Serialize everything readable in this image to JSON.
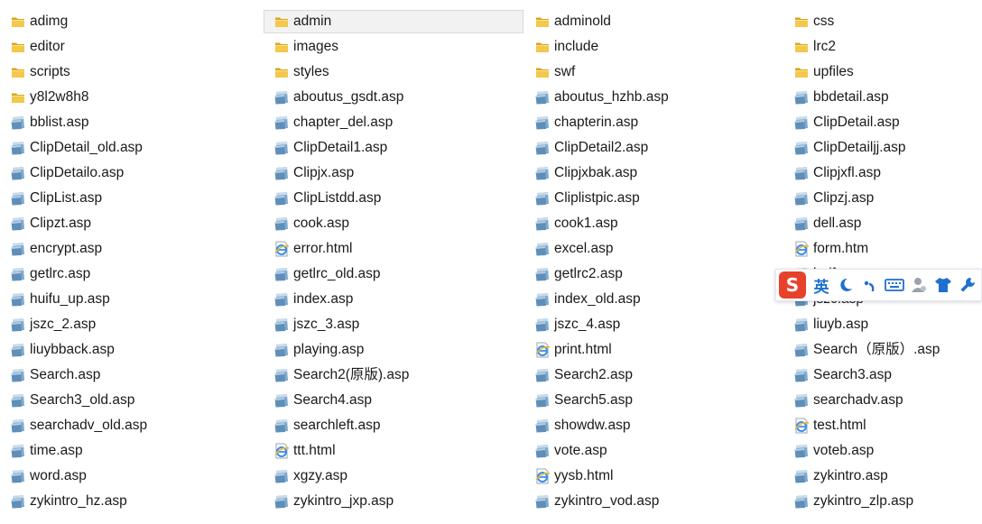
{
  "files": [
    {
      "name": "adimg",
      "type": "folder"
    },
    {
      "name": "editor",
      "type": "folder"
    },
    {
      "name": "scripts",
      "type": "folder"
    },
    {
      "name": "y8l2w8h8",
      "type": "folder"
    },
    {
      "name": "bblist.asp",
      "type": "asp"
    },
    {
      "name": "ClipDetail_old.asp",
      "type": "asp"
    },
    {
      "name": "ClipDetailo.asp",
      "type": "asp"
    },
    {
      "name": "ClipList.asp",
      "type": "asp"
    },
    {
      "name": "Clipzt.asp",
      "type": "asp"
    },
    {
      "name": "encrypt.asp",
      "type": "asp"
    },
    {
      "name": "getlrc.asp",
      "type": "asp"
    },
    {
      "name": "huifu_up.asp",
      "type": "asp"
    },
    {
      "name": "jszc_2.asp",
      "type": "asp"
    },
    {
      "name": "liuybback.asp",
      "type": "asp"
    },
    {
      "name": "Search.asp",
      "type": "asp"
    },
    {
      "name": "Search3_old.asp",
      "type": "asp"
    },
    {
      "name": "searchadv_old.asp",
      "type": "asp"
    },
    {
      "name": "time.asp",
      "type": "asp"
    },
    {
      "name": "word.asp",
      "type": "asp"
    },
    {
      "name": "zykintro_hz.asp",
      "type": "asp"
    },
    {
      "name": "admin",
      "type": "folder",
      "selected": true
    },
    {
      "name": "images",
      "type": "folder"
    },
    {
      "name": "styles",
      "type": "folder"
    },
    {
      "name": "aboutus_gsdt.asp",
      "type": "asp"
    },
    {
      "name": "chapter_del.asp",
      "type": "asp"
    },
    {
      "name": "ClipDetail1.asp",
      "type": "asp"
    },
    {
      "name": "Clipjx.asp",
      "type": "asp"
    },
    {
      "name": "ClipListdd.asp",
      "type": "asp"
    },
    {
      "name": "cook.asp",
      "type": "asp"
    },
    {
      "name": "error.html",
      "type": "html"
    },
    {
      "name": "getlrc_old.asp",
      "type": "asp"
    },
    {
      "name": "index.asp",
      "type": "asp"
    },
    {
      "name": "jszc_3.asp",
      "type": "asp"
    },
    {
      "name": "playing.asp",
      "type": "asp"
    },
    {
      "name": "Search2(原版).asp",
      "type": "asp"
    },
    {
      "name": "Search4.asp",
      "type": "asp"
    },
    {
      "name": "searchleft.asp",
      "type": "asp"
    },
    {
      "name": "ttt.html",
      "type": "html"
    },
    {
      "name": "xgzy.asp",
      "type": "asp"
    },
    {
      "name": "zykintro_jxp.asp",
      "type": "asp"
    },
    {
      "name": "adminold",
      "type": "folder"
    },
    {
      "name": "include",
      "type": "folder"
    },
    {
      "name": "swf",
      "type": "folder"
    },
    {
      "name": "aboutus_hzhb.asp",
      "type": "asp"
    },
    {
      "name": "chapterin.asp",
      "type": "asp"
    },
    {
      "name": "ClipDetail2.asp",
      "type": "asp"
    },
    {
      "name": "Clipjxbak.asp",
      "type": "asp"
    },
    {
      "name": "Cliplistpic.asp",
      "type": "asp"
    },
    {
      "name": "cook1.asp",
      "type": "asp"
    },
    {
      "name": "excel.asp",
      "type": "asp"
    },
    {
      "name": "getlrc2.asp",
      "type": "asp"
    },
    {
      "name": "index_old.asp",
      "type": "asp"
    },
    {
      "name": "jszc_4.asp",
      "type": "asp"
    },
    {
      "name": "print.html",
      "type": "html"
    },
    {
      "name": "Search2.asp",
      "type": "asp"
    },
    {
      "name": "Search5.asp",
      "type": "asp"
    },
    {
      "name": "showdw.asp",
      "type": "asp"
    },
    {
      "name": "vote.asp",
      "type": "asp"
    },
    {
      "name": "yysb.html",
      "type": "html"
    },
    {
      "name": "zykintro_vod.asp",
      "type": "asp"
    },
    {
      "name": "css",
      "type": "folder"
    },
    {
      "name": "lrc2",
      "type": "folder"
    },
    {
      "name": "upfiles",
      "type": "folder"
    },
    {
      "name": "bbdetail.asp",
      "type": "asp"
    },
    {
      "name": "ClipDetail.asp",
      "type": "asp"
    },
    {
      "name": "ClipDetailjj.asp",
      "type": "asp"
    },
    {
      "name": "Clipjxfl.asp",
      "type": "asp"
    },
    {
      "name": "Clipzj.asp",
      "type": "asp"
    },
    {
      "name": "dell.asp",
      "type": "asp"
    },
    {
      "name": "form.htm",
      "type": "html"
    },
    {
      "name": "huif",
      "type": "asp"
    },
    {
      "name": "jszc.asp",
      "type": "asp"
    },
    {
      "name": "liuyb.asp",
      "type": "asp"
    },
    {
      "name": "Search（原版）.asp",
      "type": "asp"
    },
    {
      "name": "Search3.asp",
      "type": "asp"
    },
    {
      "name": "searchadv.asp",
      "type": "asp"
    },
    {
      "name": "test.html",
      "type": "html"
    },
    {
      "name": "voteb.asp",
      "type": "asp"
    },
    {
      "name": "zykintro.asp",
      "type": "asp"
    },
    {
      "name": "zykintro_zlp.asp",
      "type": "asp"
    }
  ],
  "ime_toolbar": {
    "logo_text": "S",
    "lang_label": "英",
    "icons": [
      "moon-icon",
      "punctuation-icon",
      "keyboard-icon",
      "user-icon",
      "skin-shirt-icon",
      "wrench-icon"
    ]
  },
  "colors": {
    "folder": "#e8b838",
    "asp_file": "#7aa6c9",
    "html_ie": "#3a8ee6",
    "selected_bg": "#f2f2f2",
    "ime_logo": "#e8412b",
    "ime_blue": "#1f6fd0"
  }
}
